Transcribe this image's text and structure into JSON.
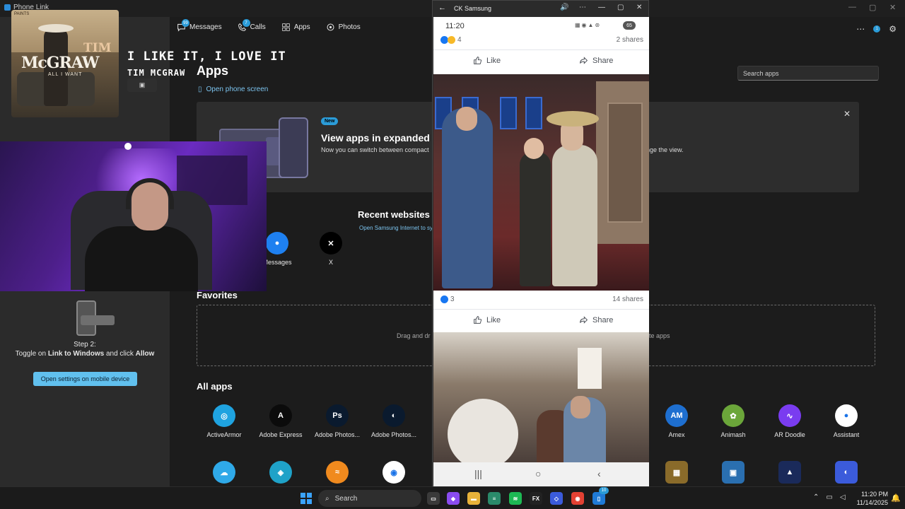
{
  "window": {
    "title": "Phone Link",
    "minimize": "—",
    "maximize": "▢",
    "close": "✕"
  },
  "nav": {
    "messages": {
      "label": "Messages",
      "badge": "99"
    },
    "calls": {
      "label": "Calls",
      "badge": "7"
    },
    "apps": {
      "label": "Apps"
    },
    "photos": {
      "label": "Photos"
    },
    "top_badge": "1"
  },
  "apps_page": {
    "heading": "Apps",
    "open_phone_screen": "Open phone screen",
    "search_placeholder": "Search apps",
    "banner": {
      "pill": "New",
      "title": "View apps in expanded sc",
      "subtitle": "Now you can switch between compact",
      "subtitle_right": "nge the view."
    },
    "recent_websites": {
      "title": "Recent websites",
      "subtitle": "Open Samsung Internet to sy"
    },
    "recent_apps": [
      {
        "label": "Messages",
        "icon": "messages-icon"
      },
      {
        "label": "X",
        "icon": "x-icon"
      }
    ],
    "favorites": {
      "title": "Favorites",
      "hint_left": "Drag and dr",
      "hint_right": "rite apps"
    },
    "all_apps_title": "All apps",
    "all_apps_row1": [
      {
        "label": "ActiveArmor",
        "color": "#1fa3e0",
        "glyph": "◎"
      },
      {
        "label": "Adobe Express",
        "color": "#0b0b0b",
        "glyph": "A"
      },
      {
        "label": "Adobe Photos...",
        "color": "#0a1a2e",
        "glyph": "Ps"
      },
      {
        "label": "Adobe Photos...",
        "color": "#0a1a2e",
        "glyph": "◐"
      },
      {
        "label": "Amex",
        "color": "#1e6fd0",
        "glyph": "AM"
      },
      {
        "label": "Animash",
        "color": "#6ba63a",
        "glyph": "✿"
      },
      {
        "label": "AR Doodle",
        "color": "#7a3cf0",
        "glyph": "∿"
      },
      {
        "label": "Assistant",
        "color": "#ffffff",
        "glyph": "●"
      }
    ],
    "all_apps_row2": [
      {
        "label": "",
        "color": "#2fa9e8",
        "glyph": "☁"
      },
      {
        "label": "",
        "color": "#1fa2c8",
        "glyph": "◈"
      },
      {
        "label": "",
        "color": "#f08a1e",
        "glyph": "≈"
      },
      {
        "label": "",
        "color": "#ffffff",
        "glyph": "◉"
      },
      {
        "label": "",
        "color": "#8a6b2a",
        "glyph": "▦"
      },
      {
        "label": "",
        "color": "#2a6fb0",
        "glyph": "▣"
      },
      {
        "label": "",
        "color": "#1a2a5a",
        "glyph": "▲"
      },
      {
        "label": "",
        "color": "#3b5bdb",
        "glyph": "◐"
      }
    ]
  },
  "setup": {
    "step_label": "Step 2:",
    "step_text_pre": "Toggle on ",
    "step_text_bold1": "Link to Windows",
    "step_text_mid": " and click ",
    "step_text_bold2": "Allow",
    "button": "Open settings on mobile device"
  },
  "now_playing": {
    "title": "I LIKE IT, I LOVE IT",
    "artist": "TIM MCGRAW",
    "album_text_top": "TIM",
    "album_text_main": "McGRAW",
    "album_text_sub": "ALL I WANT",
    "album_corner": "PAINTS"
  },
  "phone": {
    "window_title": "CK Samsung",
    "status_time": "11:20",
    "battery": "65",
    "post1": {
      "reactions": "4",
      "shares": "2 shares"
    },
    "post2": {
      "reactions": "3",
      "shares": "14 shares"
    },
    "like": "Like",
    "share": "Share",
    "nav": {
      "recents": "|||",
      "home": "○",
      "back": "‹"
    }
  },
  "taskbar": {
    "search": "Search",
    "clock_time": "11:20 PM",
    "clock_date": "11/14/2025",
    "phone_badge": "10"
  }
}
